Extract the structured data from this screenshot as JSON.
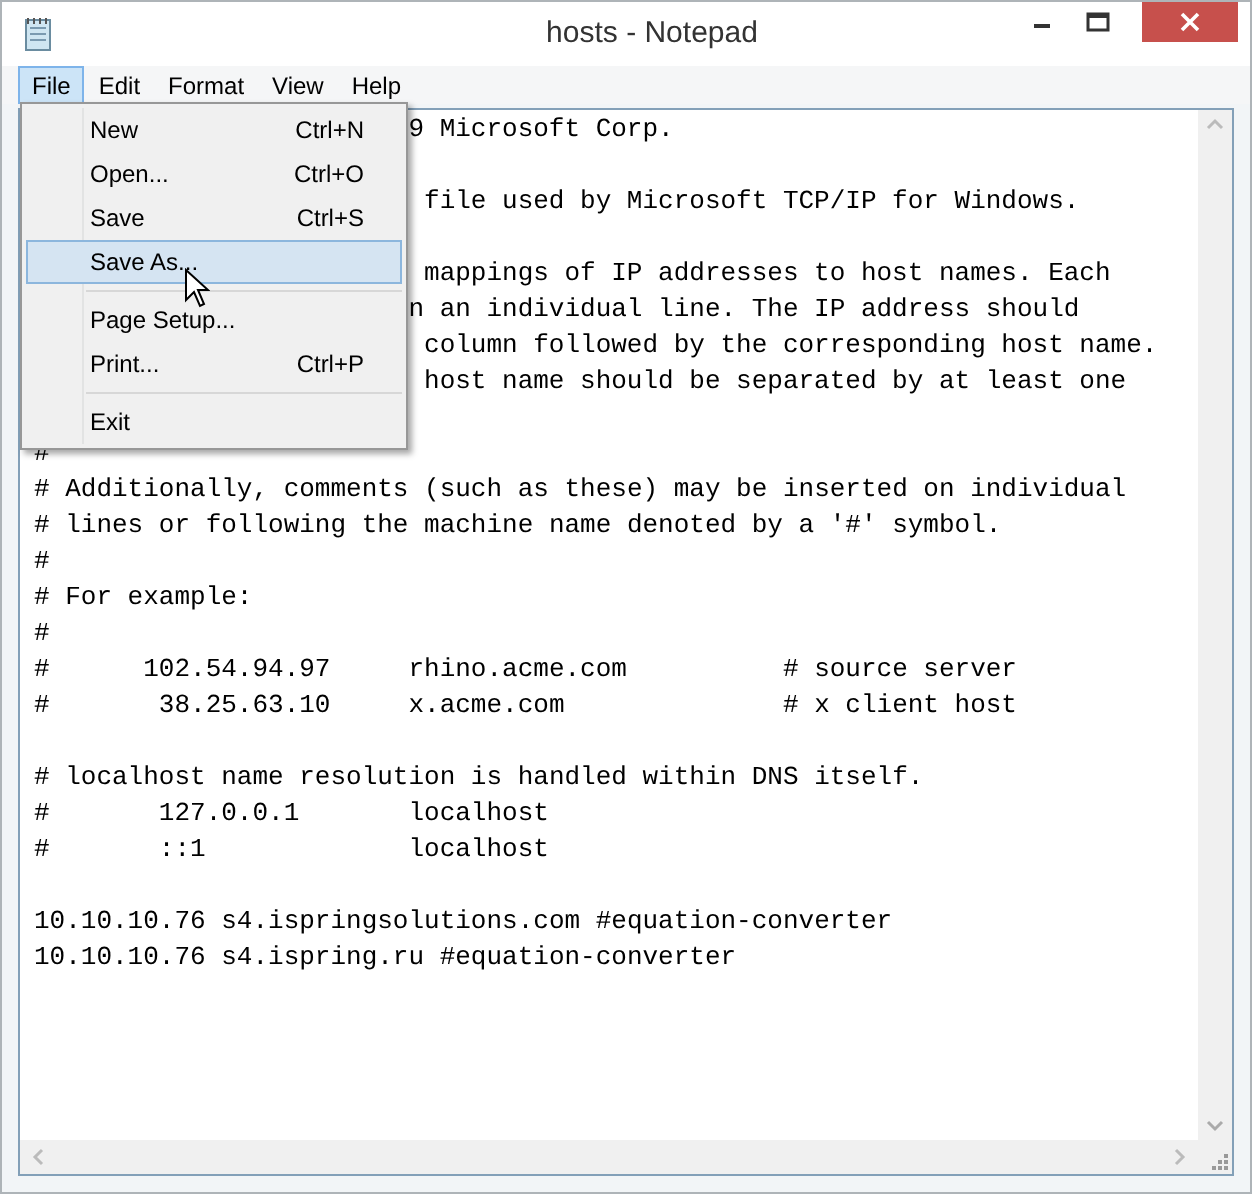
{
  "window": {
    "title": "hosts - Notepad"
  },
  "menu_bar": [
    {
      "label": "File",
      "selected": true
    },
    {
      "label": "Edit",
      "selected": false
    },
    {
      "label": "Format",
      "selected": false
    },
    {
      "label": "View",
      "selected": false
    },
    {
      "label": "Help",
      "selected": false
    }
  ],
  "file_menu": [
    {
      "kind": "item",
      "label": "New",
      "shortcut": "Ctrl+N",
      "selected": false
    },
    {
      "kind": "item",
      "label": "Open...",
      "shortcut": "Ctrl+O",
      "selected": false
    },
    {
      "kind": "item",
      "label": "Save",
      "shortcut": "Ctrl+S",
      "selected": false
    },
    {
      "kind": "item",
      "label": "Save As...",
      "selected": true
    },
    {
      "kind": "separator"
    },
    {
      "kind": "item",
      "label": "Page Setup...",
      "selected": false
    },
    {
      "kind": "item",
      "label": "Print...",
      "shortcut": "Ctrl+P",
      "selected": false
    },
    {
      "kind": "separator"
    },
    {
      "kind": "item",
      "label": "Exit",
      "selected": false
    }
  ],
  "editor_lines": [
    {
      "kind": "covered",
      "text": "9 Microsoft Corp."
    },
    {
      "kind": "blank"
    },
    {
      "kind": "covered",
      "text": " file used by Microsoft TCP/IP for Windows."
    },
    {
      "kind": "blank"
    },
    {
      "kind": "covered",
      "text": " mappings of IP addresses to host names. Each"
    },
    {
      "kind": "covered",
      "text": "n an individual line. The IP address should"
    },
    {
      "kind": "covered",
      "text": " column followed by the corresponding host name."
    },
    {
      "kind": "covered",
      "text": " host name should be separated by at least one"
    },
    {
      "kind": "blank"
    },
    {
      "kind": "text",
      "text": "#"
    },
    {
      "kind": "text",
      "text": "# Additionally, comments (such as these) may be inserted on individual"
    },
    {
      "kind": "text",
      "text": "# lines or following the machine name denoted by a '#' symbol."
    },
    {
      "kind": "text",
      "text": "#"
    },
    {
      "kind": "text",
      "text": "# For example:"
    },
    {
      "kind": "text",
      "text": "#"
    },
    {
      "kind": "text",
      "text": "#      102.54.94.97     rhino.acme.com          # source server"
    },
    {
      "kind": "text",
      "text": "#       38.25.63.10     x.acme.com              # x client host"
    },
    {
      "kind": "blank"
    },
    {
      "kind": "text",
      "text": "# localhost name resolution is handled within DNS itself."
    },
    {
      "kind": "text",
      "text": "#       127.0.0.1       localhost"
    },
    {
      "kind": "text",
      "text": "#       ::1             localhost"
    },
    {
      "kind": "blank"
    },
    {
      "kind": "text",
      "text": "10.10.10.76 s4.ispringsolutions.com #equation-converter"
    },
    {
      "kind": "text",
      "text": "10.10.10.76 s4.ispring.ru #equation-converter"
    }
  ]
}
